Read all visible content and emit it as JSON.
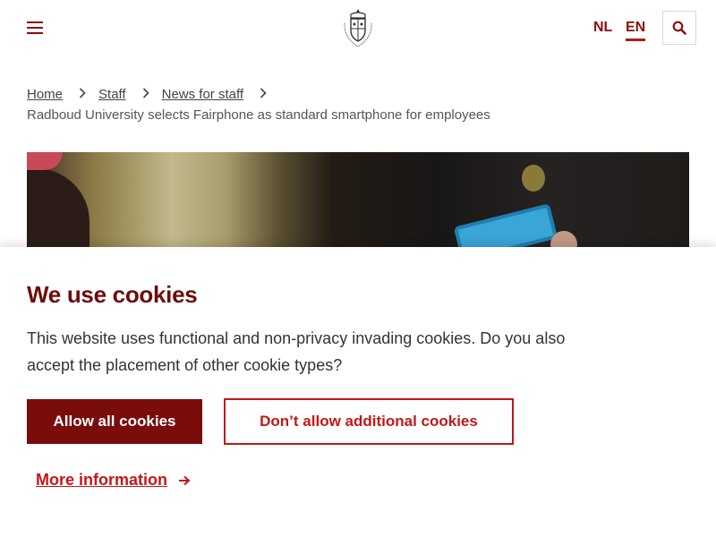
{
  "header": {
    "menu_icon": "hamburger-menu-icon",
    "logo_icon": "radboud-university-crest",
    "languages": {
      "nl": "NL",
      "en": "EN",
      "active": "EN"
    },
    "search_icon": "magnifier-icon"
  },
  "breadcrumb": {
    "items": [
      {
        "label": "Home"
      },
      {
        "label": "Staff"
      },
      {
        "label": "News for staff"
      }
    ],
    "separator_icon": "chevron-right-icon",
    "current": "Radboud University selects Fairphone as standard smartphone for employees"
  },
  "hero": {
    "description_icon": "hero-photo"
  },
  "cookie_banner": {
    "title": "We use cookies",
    "text": "This website uses functional and non-privacy invading cookies. Do you also accept the placement of other cookie types?",
    "allow_label": "Allow all cookies",
    "deny_label": "Don’t allow additional cookies",
    "more_info_label": "More information",
    "more_info_icon": "arrow-right-icon"
  },
  "colors": {
    "brand_dark_red": "#7a0c0c",
    "brand_red": "#c41717",
    "title_red": "#6e0c0c"
  }
}
